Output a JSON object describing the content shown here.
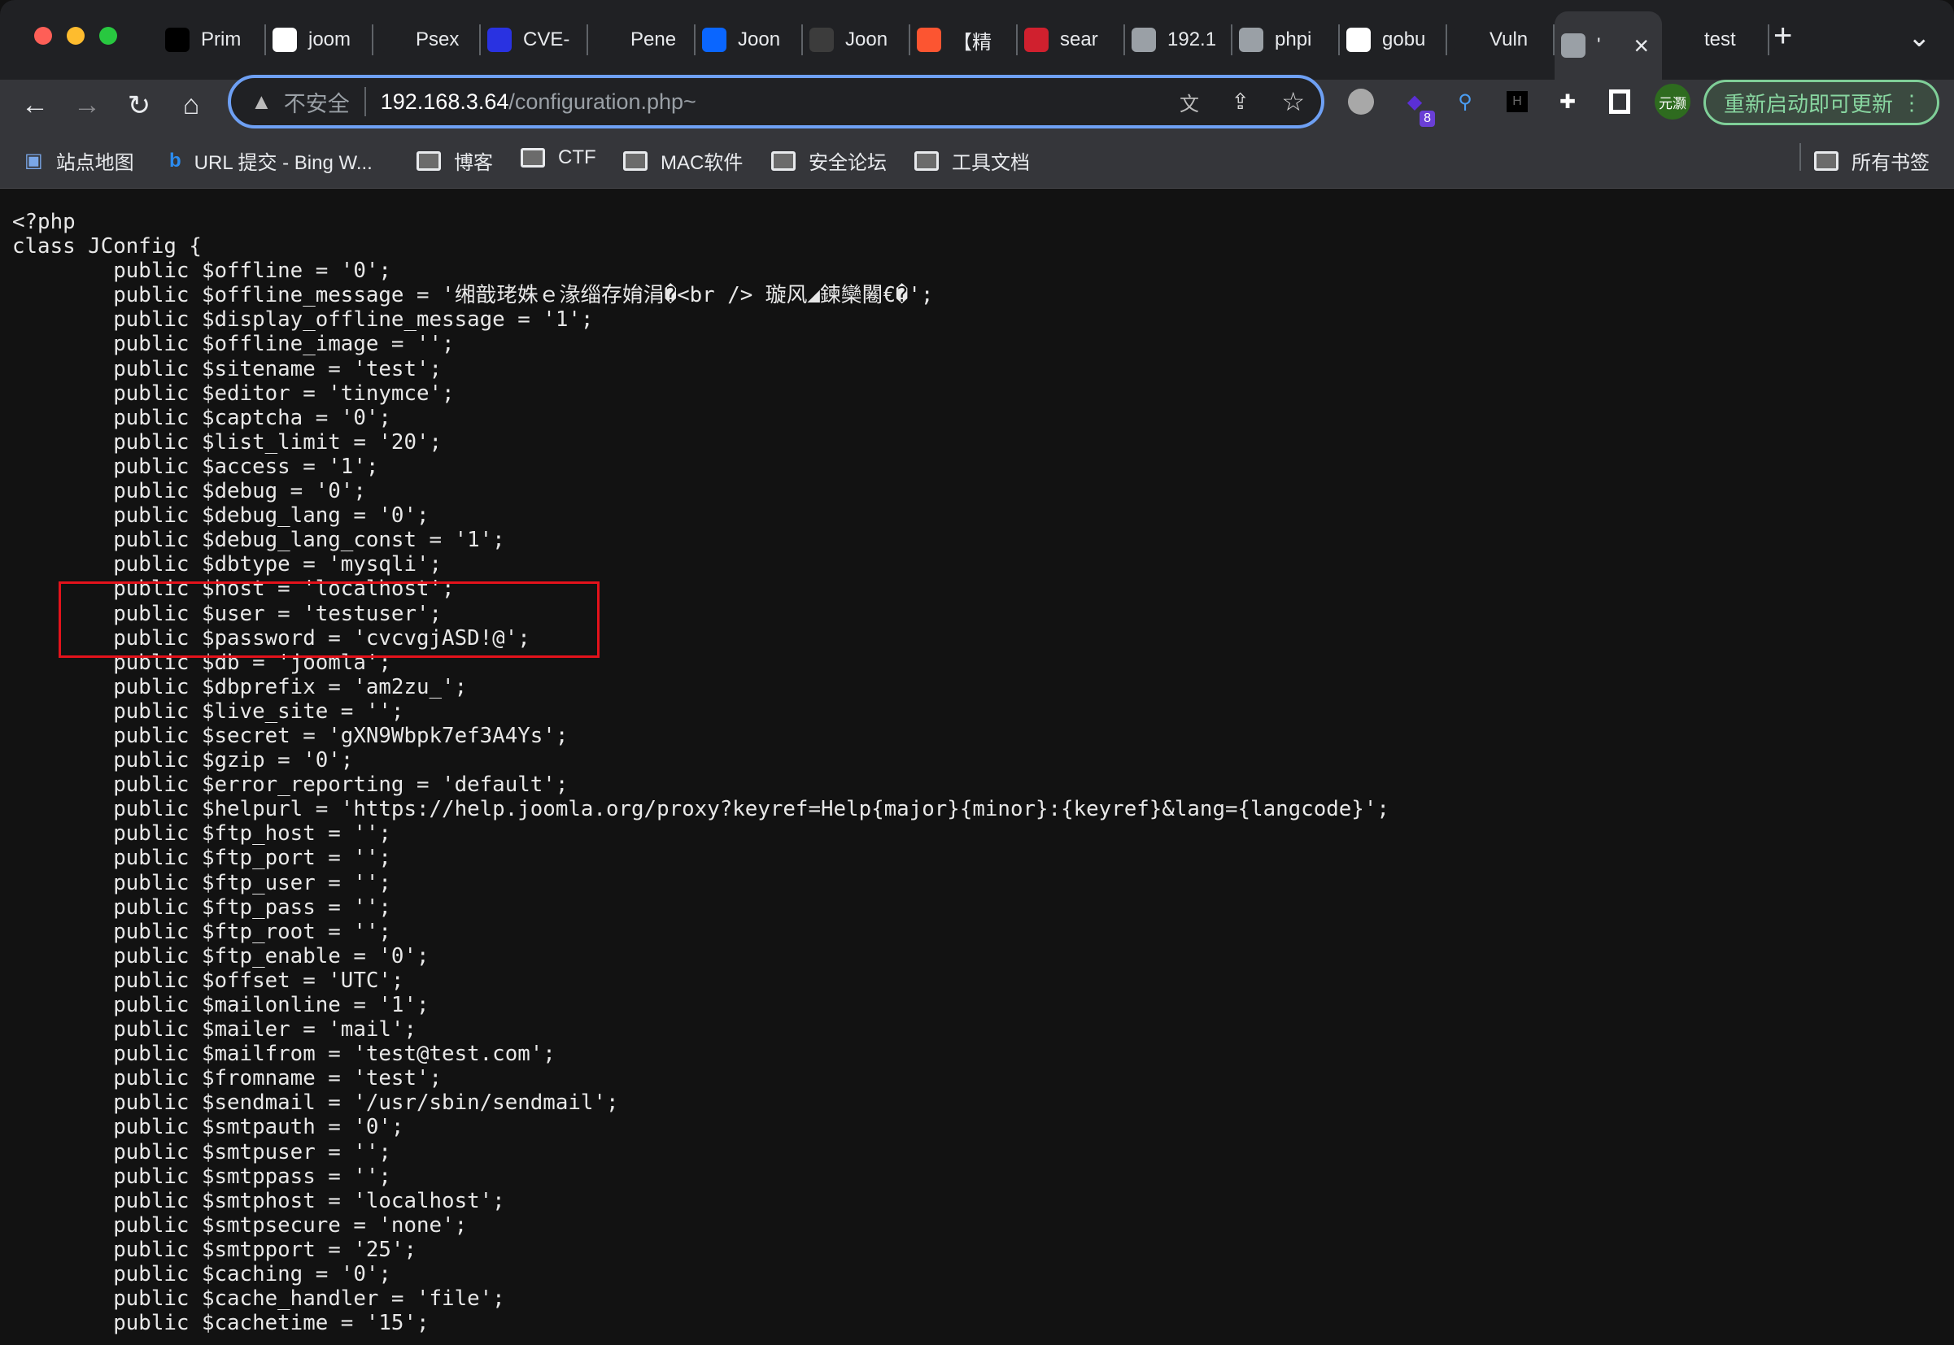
{
  "browser": {
    "tabs": [
      {
        "title": "Prim",
        "icon": "terminal-icon",
        "color": "#000000"
      },
      {
        "title": "joom",
        "icon": "google-icon",
        "color": "#ffffff"
      },
      {
        "title": "Psex",
        "icon": "vulnhub-icon",
        "color": "#202124"
      },
      {
        "title": "CVE-",
        "icon": "baidu-icon",
        "color": "#2932e1"
      },
      {
        "title": "Pene",
        "icon": "github-icon",
        "color": "#202124"
      },
      {
        "title": "Joon",
        "icon": "zhihu-icon",
        "color": "#0a66ff"
      },
      {
        "title": "Joon",
        "icon": "terminal-icon",
        "color": "#3c3c3c"
      },
      {
        "title": "【精",
        "icon": "csdn-icon",
        "color": "#fc5531"
      },
      {
        "title": "sear",
        "icon": "51cto-icon",
        "color": "#d0202e"
      },
      {
        "title": "192.1",
        "icon": "globe-icon",
        "color": "#9aa0a6"
      },
      {
        "title": "phpi",
        "icon": "globe-icon",
        "color": "#9aa0a6"
      },
      {
        "title": "gobu",
        "icon": "google-icon",
        "color": "#ffffff"
      },
      {
        "title": "Vuln",
        "icon": "vulnhub-icon",
        "color": "#202124"
      },
      {
        "title": "'",
        "icon": "globe-icon",
        "color": "#9aa0a6",
        "active": true
      },
      {
        "title": "test",
        "icon": "joomla-icon",
        "color": "#202124"
      }
    ],
    "new_tab": "+",
    "tab_search": "⌄",
    "security_label": "不安全",
    "url_host": "192.168.3.64",
    "url_path": "/configuration.php~",
    "extension_badge": "8",
    "profile_label": "元灏",
    "update_button": "重新启动即可更新",
    "bookmarks": [
      "站点地图",
      "URL 提交 - Bing W...",
      "博客",
      "CTF",
      "MAC软件",
      "安全论坛",
      "工具文档"
    ],
    "all_bookmarks": "所有书签"
  },
  "page": {
    "code_lines": [
      "<?php",
      "class JConfig {",
      "\tpublic $offline = '0';",
      "\tpublic $offline_message = '缃戠珯姝ｅ湪缁存姢涓�<br /> 璇风◢鍊欒闂€�';",
      "\tpublic $display_offline_message = '1';",
      "\tpublic $offline_image = '';",
      "\tpublic $sitename = 'test';",
      "\tpublic $editor = 'tinymce';",
      "\tpublic $captcha = '0';",
      "\tpublic $list_limit = '20';",
      "\tpublic $access = '1';",
      "\tpublic $debug = '0';",
      "\tpublic $debug_lang = '0';",
      "\tpublic $debug_lang_const = '1';",
      "\tpublic $dbtype = 'mysqli';",
      "\tpublic $host = 'localhost';",
      "\tpublic $user = 'testuser';",
      "\tpublic $password = 'cvcvgjASD!@';",
      "\tpublic $db = 'joomla';",
      "\tpublic $dbprefix = 'am2zu_';",
      "\tpublic $live_site = '';",
      "\tpublic $secret = 'gXN9Wbpk7ef3A4Ys';",
      "\tpublic $gzip = '0';",
      "\tpublic $error_reporting = 'default';",
      "\tpublic $helpurl = 'https://help.joomla.org/proxy?keyref=Help{major}{minor}:{keyref}&lang={langcode}';",
      "\tpublic $ftp_host = '';",
      "\tpublic $ftp_port = '';",
      "\tpublic $ftp_user = '';",
      "\tpublic $ftp_pass = '';",
      "\tpublic $ftp_root = '';",
      "\tpublic $ftp_enable = '0';",
      "\tpublic $offset = 'UTC';",
      "\tpublic $mailonline = '1';",
      "\tpublic $mailer = 'mail';",
      "\tpublic $mailfrom = 'test@test.com';",
      "\tpublic $fromname = 'test';",
      "\tpublic $sendmail = '/usr/sbin/sendmail';",
      "\tpublic $smtpauth = '0';",
      "\tpublic $smtpuser = '';",
      "\tpublic $smtppass = '';",
      "\tpublic $smtphost = 'localhost';",
      "\tpublic $smtpsecure = 'none';",
      "\tpublic $smtpport = '25';",
      "\tpublic $caching = '0';",
      "\tpublic $cache_handler = 'file';",
      "\tpublic $cachetime = '15';"
    ],
    "highlight_color": "#e3121b"
  }
}
